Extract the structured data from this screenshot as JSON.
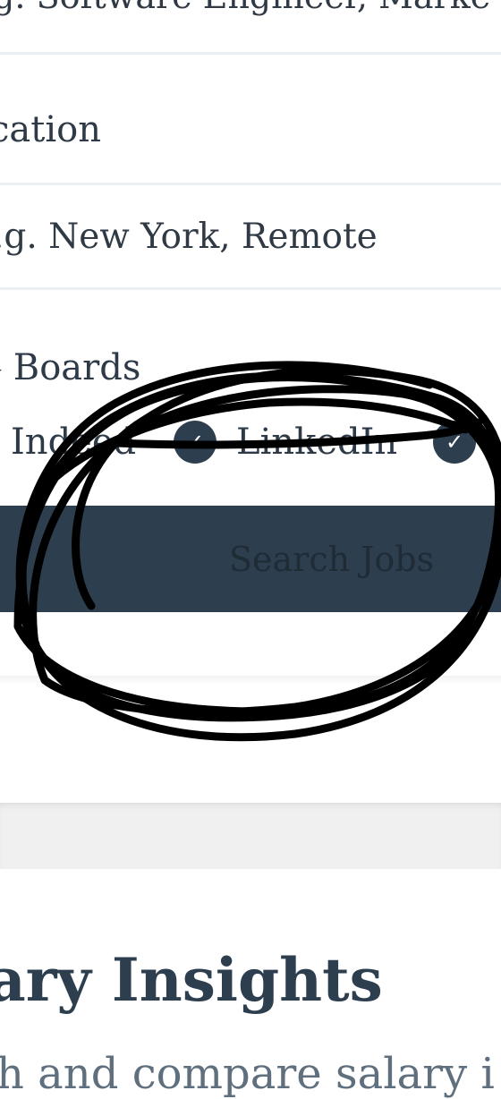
{
  "search_form": {
    "job_title_placeholder": ".g. Software Engineer, Marke",
    "location_label": "cation",
    "location_placeholder": ".g. New York, Remote",
    "job_boards_label": "Boards",
    "boards": [
      {
        "label": "Indeed",
        "checked": true
      },
      {
        "label": "LinkedIn",
        "checked": true
      },
      {
        "label": "",
        "checked": true
      }
    ],
    "search_button_label": "Search Jobs"
  },
  "salary": {
    "title": "ary Insights",
    "subtitle": "h and compare salary i"
  },
  "colors": {
    "primary": "#2d3e4f",
    "annotation_ink": "#000000"
  }
}
